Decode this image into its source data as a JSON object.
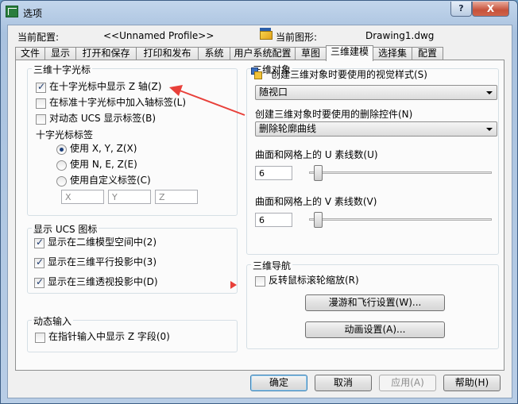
{
  "window": {
    "title": "选项",
    "help_glyph": "?",
    "close_glyph": "X"
  },
  "profile": {
    "caption": "当前配置:",
    "value": "<<Unnamed Profile>>"
  },
  "drawing": {
    "caption": "当前图形:",
    "value": "Drawing1.dwg"
  },
  "tabs": [
    {
      "label": "文件"
    },
    {
      "label": "显示"
    },
    {
      "label": "打开和保存"
    },
    {
      "label": "打印和发布"
    },
    {
      "label": "系统"
    },
    {
      "label": "用户系统配置"
    },
    {
      "label": "草图"
    },
    {
      "label": "三维建模",
      "active": true
    },
    {
      "label": "选择集"
    },
    {
      "label": "配置"
    }
  ],
  "crosshair": {
    "title": "三维十字光标",
    "show_z_axis": {
      "label": "在十字光标中显示 Z 轴(Z)",
      "checked": true
    },
    "label_axes": {
      "label": "在标准十字光标中加入轴标签(L)",
      "checked": false
    },
    "ucs_labels": {
      "label": "对动态 UCS 显示标签(B)",
      "checked": false
    },
    "labels_caption": "十字光标标签",
    "radio_xyz": {
      "label": "使用 X, Y, Z(X)",
      "checked": true
    },
    "radio_nez": {
      "label": "使用 N, E, Z(E)",
      "checked": false
    },
    "radio_custom": {
      "label": "使用自定义标签(C)",
      "checked": false
    },
    "custom": {
      "x": "X",
      "y": "Y",
      "z": "Z"
    }
  },
  "ucs_icon": {
    "title": "显示 UCS 图标",
    "model_2d": {
      "label": "显示在二维模型空间中(2)",
      "checked": true
    },
    "parallel_3d": {
      "label": "显示在三维平行投影中(3)",
      "checked": true
    },
    "perspective_3d": {
      "label": "显示在三维透视投影中(D)",
      "checked": true
    }
  },
  "dynamic_input": {
    "title": "动态输入",
    "show_z": {
      "label": "在指针输入中显示 Z 字段(0)",
      "checked": false
    }
  },
  "objects_3d": {
    "title": "三维对象",
    "visual_style_caption": "创建三维对象时要使用的视觉样式(S)",
    "visual_style_value": "随视口",
    "deletion_caption": "创建三维对象时要使用的删除控件(N)",
    "deletion_value": "删除轮廓曲线",
    "u_caption": "曲面和网格上的 U 素线数(U)",
    "u_value": "6",
    "v_caption": "曲面和网格上的 V 素线数(V)",
    "v_value": "6"
  },
  "navigation": {
    "title": "三维导航",
    "reverse_zoom": {
      "label": "反转鼠标滚轮缩放(R)",
      "checked": false
    },
    "walk_fly_label": "漫游和飞行设置(W)...",
    "animation_label": "动画设置(A)..."
  },
  "footer": {
    "ok": "确定",
    "cancel": "取消",
    "apply": "应用(A)",
    "help": "帮助(H)"
  },
  "colors": {
    "annotation_arrow": "#e8403a"
  }
}
